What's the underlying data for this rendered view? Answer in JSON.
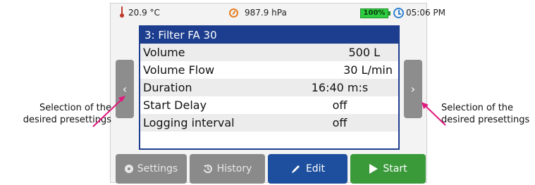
{
  "status": {
    "temperature": "20.9 °C",
    "pressure": "987.9 hPa",
    "battery": "100%",
    "time": "05:06 PM"
  },
  "panel": {
    "title": "3: Filter FA 30",
    "rows": [
      {
        "label": "Volume",
        "value": "500 L"
      },
      {
        "label": "Volume Flow",
        "value": "30 L/min"
      },
      {
        "label": "Duration",
        "value": "16:40 m:s"
      },
      {
        "label": "Start Delay",
        "value": "off"
      },
      {
        "label": "Logging interval",
        "value": "off"
      }
    ]
  },
  "nav": {
    "prev_label": "‹",
    "next_label": "›"
  },
  "buttons": {
    "settings": "Settings",
    "history": "History",
    "edit": "Edit",
    "start": "Start"
  },
  "icons": {
    "settings": "gear-icon",
    "history": "history-icon",
    "edit": "pencil-icon",
    "start": "play-icon"
  },
  "captions": {
    "left": "Selection of the desired presettings",
    "right": "Selection of the desired presettings"
  },
  "colors": {
    "panel_border": "#1d3e8f",
    "edit_button": "#1d4f9e",
    "start_button": "#3a9a3a",
    "arrow": "#e0197d"
  }
}
